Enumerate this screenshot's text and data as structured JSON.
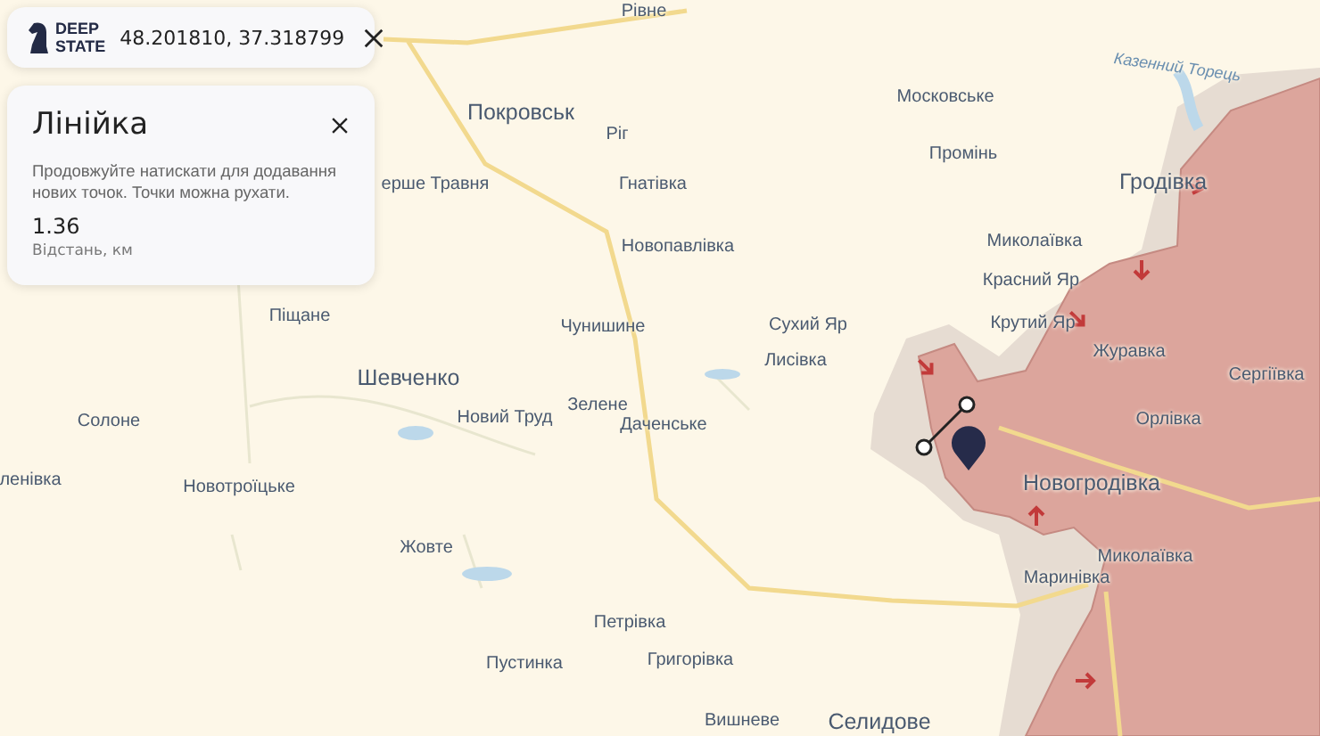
{
  "header": {
    "logo_lines": [
      "DEEP",
      "STATE"
    ],
    "coordinates": "48.201810, 37.318799"
  },
  "ruler": {
    "title": "Лінійка",
    "hint": "Продовжуйте натискати для додавання нових точок. Точки можна рухати.",
    "distance": "1.36",
    "distance_label": "Відстань, км"
  },
  "map_labels": [
    {
      "text": "Рівне",
      "kind": "village"
    },
    {
      "text": "Казенний Торець",
      "kind": "river"
    },
    {
      "text": "Московське",
      "kind": "village"
    },
    {
      "text": "Покровськ",
      "kind": "city"
    },
    {
      "text": "Ріг",
      "kind": "village"
    },
    {
      "text": "Промінь",
      "kind": "village"
    },
    {
      "text": "ерше Травня",
      "kind": "village"
    },
    {
      "text": "Гнатівка",
      "kind": "village"
    },
    {
      "text": "Гродівка",
      "kind": "city"
    },
    {
      "text": "Новопавлівка",
      "kind": "village"
    },
    {
      "text": "Миколаївка",
      "kind": "village"
    },
    {
      "text": "Красний Яр",
      "kind": "village"
    },
    {
      "text": "Піщане",
      "kind": "village"
    },
    {
      "text": "Чунишине",
      "kind": "village"
    },
    {
      "text": "Сухий Яр",
      "kind": "village"
    },
    {
      "text": "Крутий Яр",
      "kind": "village"
    },
    {
      "text": "Лисівка",
      "kind": "village"
    },
    {
      "text": "Журавка",
      "kind": "village"
    },
    {
      "text": "Шевченко",
      "kind": "city"
    },
    {
      "text": "Сергіївка",
      "kind": "village"
    },
    {
      "text": "Солоне",
      "kind": "village"
    },
    {
      "text": "Новий Труд",
      "kind": "village"
    },
    {
      "text": "Зелене",
      "kind": "village"
    },
    {
      "text": "Даченське",
      "kind": "village"
    },
    {
      "text": "Орлівка",
      "kind": "village"
    },
    {
      "text": "ленівка",
      "kind": "village"
    },
    {
      "text": "Новотроїцьке",
      "kind": "village"
    },
    {
      "text": "Новогродівка",
      "kind": "city"
    },
    {
      "text": "Жовте",
      "kind": "village"
    },
    {
      "text": "Миколаївка",
      "kind": "village"
    },
    {
      "text": "Маринівка",
      "kind": "village"
    },
    {
      "text": "Петрівка",
      "kind": "village"
    },
    {
      "text": "Пустинка",
      "kind": "village"
    },
    {
      "text": "Григорівка",
      "kind": "village"
    },
    {
      "text": "Вишневе",
      "kind": "village"
    },
    {
      "text": "Селидове",
      "kind": "city"
    }
  ]
}
